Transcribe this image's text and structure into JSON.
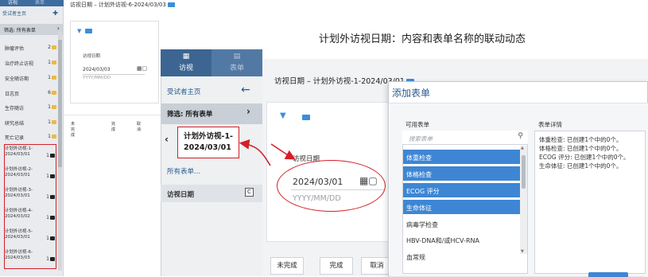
{
  "left_sidebar": {
    "tabs": [
      "访视",
      "表单"
    ],
    "home": "受试者主页",
    "filter": "筛选: 所有表单",
    "items": [
      {
        "label": "肿瘤评估",
        "count": "2"
      },
      {
        "label": "治疗终止访视",
        "count": "1"
      },
      {
        "label": "安全随访期",
        "count": "1"
      },
      {
        "label": "日志页",
        "count": "6"
      },
      {
        "label": "生存随访",
        "count": "1"
      },
      {
        "label": "研究总结",
        "count": "1"
      },
      {
        "label": "死亡记录",
        "count": "1"
      }
    ],
    "visits": [
      {
        "label": "计划外访视-1-\n2024/03/01",
        "count": "1"
      },
      {
        "label": "计划外访视-2-\n2024/03/01",
        "count": "1"
      },
      {
        "label": "计划外访视-3-\n2024/03/01",
        "count": "1"
      },
      {
        "label": "计划外访视-4-\n2024/03/02",
        "count": "1"
      },
      {
        "label": "计划外访视-5-\n2024/03/01",
        "count": "1"
      },
      {
        "label": "计划外访视-6-\n2024/03/03",
        "count": "1"
      }
    ]
  },
  "back_page": {
    "title": "访视日期 – 计划外访视-6-2024/03/03",
    "date_label": "访视日期",
    "date_value": "2024/03/03",
    "date_placeholder": "YYYY/MM/DD",
    "buttons": [
      "未完成",
      "完成",
      "取消"
    ]
  },
  "middle_nav": {
    "tab_visit": "访视",
    "tab_form": "表单",
    "home": "受试者主页",
    "filter": "筛选: 所有表单",
    "current_visit": "计划外访视-1-\n2024/03/01",
    "all_forms": "所有表单...",
    "visit_date": "访视日期",
    "visit_date_icon_text": "C"
  },
  "headline": "计划外访视日期：内容和表单名称的联动动态",
  "main_page": {
    "title": "访视日期 – 计划外访视-1-2024/03/01",
    "date_label": "访视日期",
    "date_value": "2024/03/01",
    "date_placeholder": "YYYY/MM/DD",
    "buttons": [
      "未完成",
      "完成",
      "取消"
    ]
  },
  "dialog": {
    "title": "添加表单",
    "available_label": "可用表单",
    "detail_label": "表单详情",
    "search_placeholder": "搜索表单",
    "items": [
      {
        "label": "体重检查",
        "selected": true
      },
      {
        "label": "体格检查",
        "selected": true
      },
      {
        "label": "ECOG 评分",
        "selected": true
      },
      {
        "label": "生命体征",
        "selected": true
      },
      {
        "label": "病毒学检查",
        "selected": false
      },
      {
        "label": "HBV-DNA和/或HCV-RNA",
        "selected": false
      },
      {
        "label": "血常规",
        "selected": false
      }
    ],
    "details": [
      "体重检查: 已创建1个中的0个。",
      "体格检查: 已创建1个中的0个。",
      "ECOG 评分: 已创建1个中的0个。",
      "生命体征: 已创建1个中的0个。"
    ]
  },
  "colors": {
    "accent": "#3e86d4",
    "nav_blue": "#3c6592",
    "highlight_red": "#d32027",
    "folder_yellow": "#f0b840"
  },
  "icons": [
    "chevron-right-icon",
    "arrow-left-icon",
    "calendar-icon",
    "search-icon",
    "folder-icon",
    "tag-icon",
    "caret-down-icon"
  ]
}
